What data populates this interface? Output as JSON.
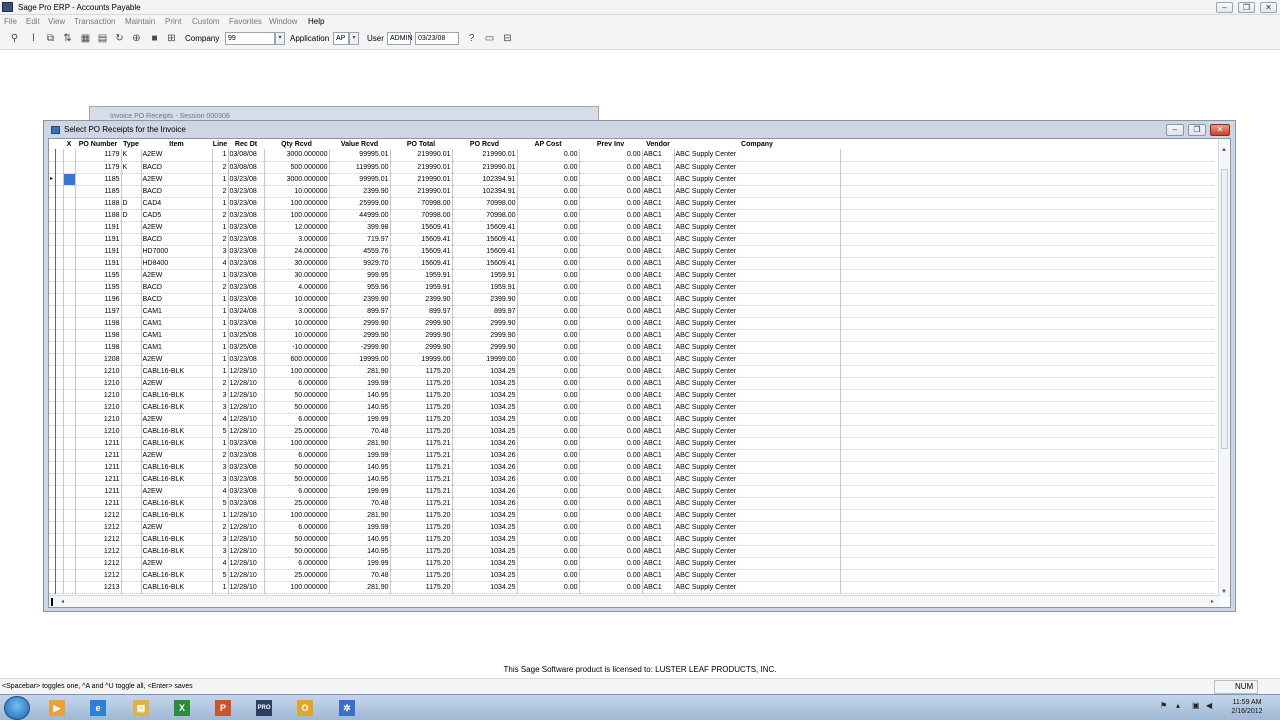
{
  "window": {
    "title": "Sage Pro ERP - Accounts Payable"
  },
  "menu": [
    "File",
    "Edit",
    "View",
    "Transaction",
    "Maintain",
    "Print",
    "Custom",
    "Favorites",
    "Window",
    "Help"
  ],
  "toolbar": {
    "company_label": "Company",
    "company_value": "99",
    "application_label": "Application",
    "application_value": "AP",
    "user_label": "User",
    "user_value": "ADMIN",
    "date_value": "03/23/08"
  },
  "background_window": {
    "title": "Invoice PO Receipts - Session 000306"
  },
  "dialog": {
    "title": "Select PO Receipts for the Invoice"
  },
  "grid": {
    "headers": [
      "X",
      "PO Number",
      "Type",
      "Item",
      "Line",
      "Rec Dt",
      "Qty Rcvd",
      "Value Rcvd",
      "PO Total",
      "PO Rcvd",
      "AP Cost",
      "Prev Inv",
      "Vendor",
      "Company"
    ],
    "current_row": 2,
    "rows": [
      [
        "",
        "1179",
        "K",
        "A2EW",
        "1",
        "03/08/08",
        "3000.000000",
        "99995.01",
        "219990.01",
        "219990.01",
        "0.00",
        "0.00",
        "ABC1",
        "ABC Supply Center"
      ],
      [
        "",
        "1179",
        "K",
        "BACD",
        "2",
        "03/08/08",
        "500.000000",
        "119995.00",
        "219990.01",
        "219990.01",
        "0.00",
        "0.00",
        "ABC1",
        "ABC Supply Center"
      ],
      [
        "",
        "1185",
        "",
        "A2EW",
        "1",
        "03/23/08",
        "3000.000000",
        "99995.01",
        "219990.01",
        "102394.91",
        "0.00",
        "0.00",
        "ABC1",
        "ABC Supply Center"
      ],
      [
        "",
        "1185",
        "",
        "BACD",
        "2",
        "03/23/08",
        "10.000000",
        "2399.90",
        "219990.01",
        "102394.91",
        "0.00",
        "0.00",
        "ABC1",
        "ABC Supply Center"
      ],
      [
        "",
        "1188",
        "D",
        "CAD4",
        "1",
        "03/23/08",
        "100.000000",
        "25999.00",
        "70998.00",
        "70998.00",
        "0.00",
        "0.00",
        "ABC1",
        "ABC Supply Center"
      ],
      [
        "",
        "1188",
        "D",
        "CAD5",
        "2",
        "03/23/08",
        "100.000000",
        "44999.00",
        "70998.00",
        "70998.00",
        "0.00",
        "0.00",
        "ABC1",
        "ABC Supply Center"
      ],
      [
        "",
        "1191",
        "",
        "A2EW",
        "1",
        "03/23/08",
        "12.000000",
        "399.98",
        "15609.41",
        "15609.41",
        "0.00",
        "0.00",
        "ABC1",
        "ABC Supply Center"
      ],
      [
        "",
        "1191",
        "",
        "BACD",
        "2",
        "03/23/08",
        "3.000000",
        "719.97",
        "15609.41",
        "15609.41",
        "0.00",
        "0.00",
        "ABC1",
        "ABC Supply Center"
      ],
      [
        "",
        "1191",
        "",
        "HD7000",
        "3",
        "03/23/08",
        "24.000000",
        "4559.76",
        "15609.41",
        "15609.41",
        "0.00",
        "0.00",
        "ABC1",
        "ABC Supply Center"
      ],
      [
        "",
        "1191",
        "",
        "HD8400",
        "4",
        "03/23/08",
        "30.000000",
        "9929.70",
        "15609.41",
        "15609.41",
        "0.00",
        "0.00",
        "ABC1",
        "ABC Supply Center"
      ],
      [
        "",
        "1195",
        "",
        "A2EW",
        "1",
        "03/23/08",
        "30.000000",
        "999.95",
        "1959.91",
        "1959.91",
        "0.00",
        "0.00",
        "ABC1",
        "ABC Supply Center"
      ],
      [
        "",
        "1195",
        "",
        "BACD",
        "2",
        "03/23/08",
        "4.000000",
        "959.96",
        "1959.91",
        "1959.91",
        "0.00",
        "0.00",
        "ABC1",
        "ABC Supply Center"
      ],
      [
        "",
        "1196",
        "",
        "BACD",
        "1",
        "03/23/08",
        "10.000000",
        "2399.90",
        "2399.90",
        "2399.90",
        "0.00",
        "0.00",
        "ABC1",
        "ABC Supply Center"
      ],
      [
        "",
        "1197",
        "",
        "CAM1",
        "1",
        "03/24/08",
        "3.000000",
        "899.97",
        "899.97",
        "899.97",
        "0.00",
        "0.00",
        "ABC1",
        "ABC Supply Center"
      ],
      [
        "",
        "1198",
        "",
        "CAM1",
        "1",
        "03/23/08",
        "10.000000",
        "2999.90",
        "2999.90",
        "2999.90",
        "0.00",
        "0.00",
        "ABC1",
        "ABC Supply Center"
      ],
      [
        "",
        "1198",
        "",
        "CAM1",
        "1",
        "03/25/08",
        "10.000000",
        "2999.90",
        "2999.90",
        "2999.90",
        "0.00",
        "0.00",
        "ABC1",
        "ABC Supply Center"
      ],
      [
        "",
        "1198",
        "",
        "CAM1",
        "1",
        "03/25/08",
        "-10.000000",
        "-2999.90",
        "2999.90",
        "2999.90",
        "0.00",
        "0.00",
        "ABC1",
        "ABC Supply Center"
      ],
      [
        "",
        "1208",
        "",
        "A2EW",
        "1",
        "03/23/08",
        "600.000000",
        "19999.00",
        "19999.00",
        "19999.00",
        "0.00",
        "0.00",
        "ABC1",
        "ABC Supply Center"
      ],
      [
        "",
        "1210",
        "",
        "CABL16-BLK",
        "1",
        "12/28/10",
        "100.000000",
        "281.90",
        "1175.20",
        "1034.25",
        "0.00",
        "0.00",
        "ABC1",
        "ABC Supply Center"
      ],
      [
        "",
        "1210",
        "",
        "A2EW",
        "2",
        "12/28/10",
        "6.000000",
        "199.99",
        "1175.20",
        "1034.25",
        "0.00",
        "0.00",
        "ABC1",
        "ABC Supply Center"
      ],
      [
        "",
        "1210",
        "",
        "CABL16-BLK",
        "3",
        "12/28/10",
        "50.000000",
        "140.95",
        "1175.20",
        "1034.25",
        "0.00",
        "0.00",
        "ABC1",
        "ABC Supply Center"
      ],
      [
        "",
        "1210",
        "",
        "CABL16-BLK",
        "3",
        "12/28/10",
        "50.000000",
        "140.95",
        "1175.20",
        "1034.25",
        "0.00",
        "0.00",
        "ABC1",
        "ABC Supply Center"
      ],
      [
        "",
        "1210",
        "",
        "A2EW",
        "4",
        "12/28/10",
        "6.000000",
        "199.99",
        "1175.20",
        "1034.25",
        "0.00",
        "0.00",
        "ABC1",
        "ABC Supply Center"
      ],
      [
        "",
        "1210",
        "",
        "CABL16-BLK",
        "5",
        "12/28/10",
        "25.000000",
        "70.48",
        "1175.20",
        "1034.25",
        "0.00",
        "0.00",
        "ABC1",
        "ABC Supply Center"
      ],
      [
        "",
        "1211",
        "",
        "CABL16-BLK",
        "1",
        "03/23/08",
        "100.000000",
        "281.90",
        "1175.21",
        "1034.26",
        "0.00",
        "0.00",
        "ABC1",
        "ABC Supply Center"
      ],
      [
        "",
        "1211",
        "",
        "A2EW",
        "2",
        "03/23/08",
        "6.000000",
        "199.99",
        "1175.21",
        "1034.26",
        "0.00",
        "0.00",
        "ABC1",
        "ABC Supply Center"
      ],
      [
        "",
        "1211",
        "",
        "CABL16-BLK",
        "3",
        "03/23/08",
        "50.000000",
        "140.95",
        "1175.21",
        "1034.26",
        "0.00",
        "0.00",
        "ABC1",
        "ABC Supply Center"
      ],
      [
        "",
        "1211",
        "",
        "CABL16-BLK",
        "3",
        "03/23/08",
        "50.000000",
        "140.95",
        "1175.21",
        "1034.26",
        "0.00",
        "0.00",
        "ABC1",
        "ABC Supply Center"
      ],
      [
        "",
        "1211",
        "",
        "A2EW",
        "4",
        "03/23/08",
        "6.000000",
        "199.99",
        "1175.21",
        "1034.26",
        "0.00",
        "0.00",
        "ABC1",
        "ABC Supply Center"
      ],
      [
        "",
        "1211",
        "",
        "CABL16-BLK",
        "5",
        "03/23/08",
        "25.000000",
        "70.48",
        "1175.21",
        "1034.26",
        "0.00",
        "0.00",
        "ABC1",
        "ABC Supply Center"
      ],
      [
        "",
        "1212",
        "",
        "CABL16-BLK",
        "1",
        "12/28/10",
        "100.000000",
        "281.90",
        "1175.20",
        "1034.25",
        "0.00",
        "0.00",
        "ABC1",
        "ABC Supply Center"
      ],
      [
        "",
        "1212",
        "",
        "A2EW",
        "2",
        "12/28/10",
        "6.000000",
        "199.99",
        "1175.20",
        "1034.25",
        "0.00",
        "0.00",
        "ABC1",
        "ABC Supply Center"
      ],
      [
        "",
        "1212",
        "",
        "CABL16-BLK",
        "3",
        "12/28/10",
        "50.000000",
        "140.95",
        "1175.20",
        "1034.25",
        "0.00",
        "0.00",
        "ABC1",
        "ABC Supply Center"
      ],
      [
        "",
        "1212",
        "",
        "CABL16-BLK",
        "3",
        "12/28/10",
        "50.000000",
        "140.95",
        "1175.20",
        "1034.25",
        "0.00",
        "0.00",
        "ABC1",
        "ABC Supply Center"
      ],
      [
        "",
        "1212",
        "",
        "A2EW",
        "4",
        "12/28/10",
        "6.000000",
        "199.99",
        "1175.20",
        "1034.25",
        "0.00",
        "0.00",
        "ABC1",
        "ABC Supply Center"
      ],
      [
        "",
        "1212",
        "",
        "CABL16-BLK",
        "5",
        "12/28/10",
        "25.000000",
        "70.48",
        "1175.20",
        "1034.25",
        "0.00",
        "0.00",
        "ABC1",
        "ABC Supply Center"
      ],
      [
        "",
        "1213",
        "",
        "CABL16-BLK",
        "1",
        "12/28/10",
        "100.000000",
        "281.90",
        "1175.20",
        "1034.25",
        "0.00",
        "0.00",
        "ABC1",
        "ABC Supply Center"
      ]
    ]
  },
  "license_text": "This Sage Software product is licensed to: LUSTER LEAF PRODUCTS, INC.",
  "status": {
    "hint": "<Spacebar> toggles one, ^A and ^U toggle all, <Enter> saves",
    "num": "NUM"
  },
  "taskbar": {
    "apps": [
      {
        "icon": "media-player-icon",
        "glyph": "▶",
        "color": "#e8a23a"
      },
      {
        "icon": "internet-explorer-icon",
        "glyph": "e",
        "color": "#2f7fd6"
      },
      {
        "icon": "file-explorer-icon",
        "glyph": "▤",
        "color": "#d9b24a"
      },
      {
        "icon": "excel-icon",
        "glyph": "X",
        "color": "#2e8b3e"
      },
      {
        "icon": "powerpoint-icon",
        "glyph": "P",
        "color": "#c8552d"
      },
      {
        "icon": "sage-pro-icon",
        "glyph": "PRO",
        "color": "#2d3e63"
      },
      {
        "icon": "outlook-icon",
        "glyph": "O",
        "color": "#e1a52b"
      },
      {
        "icon": "network-app-icon",
        "glyph": "✲",
        "color": "#3a6fc4"
      }
    ],
    "time": "11:59 AM",
    "date": "2/16/2012"
  }
}
